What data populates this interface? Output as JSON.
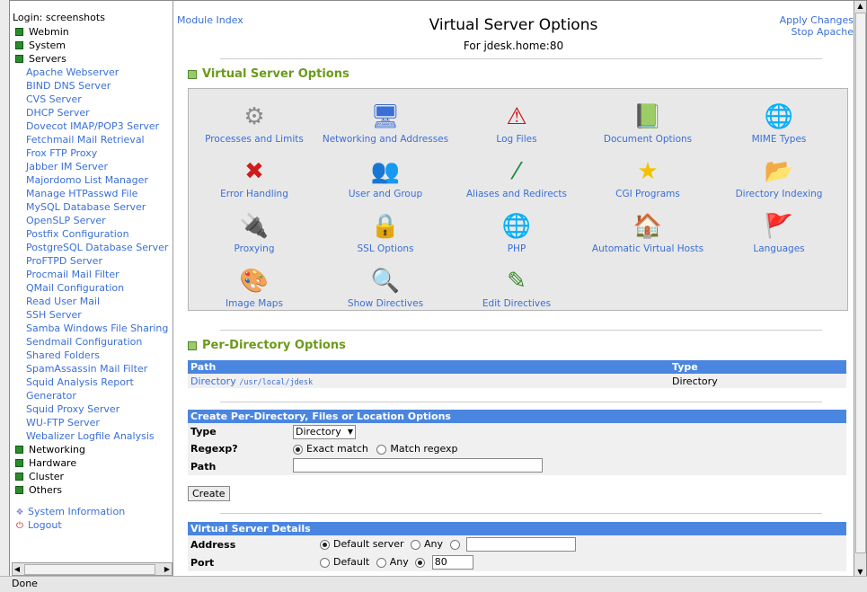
{
  "left": {
    "login": "Login: screenshots",
    "categories_top": [
      "Webmin",
      "System",
      "Servers"
    ],
    "servers": [
      "Apache Webserver",
      "BIND DNS Server",
      "CVS Server",
      "DHCP Server",
      "Dovecot IMAP/POP3 Server",
      "Fetchmail Mail Retrieval",
      "Frox FTP Proxy",
      "Jabber IM Server",
      "Majordomo List Manager",
      "Manage HTPasswd File",
      "MySQL Database Server",
      "OpenSLP Server",
      "Postfix Configuration",
      "PostgreSQL Database Server",
      "ProFTPD Server",
      "Procmail Mail Filter",
      "QMail Configuration",
      "Read User Mail",
      "SSH Server",
      "Samba Windows File Sharing",
      "Sendmail Configuration",
      "Shared Folders",
      "SpamAssassin Mail Filter",
      "Squid Analysis Report Generator",
      "Squid Proxy Server",
      "WU-FTP Server",
      "Webalizer Logfile Analysis"
    ],
    "categories_bottom": [
      "Networking",
      "Hardware",
      "Cluster",
      "Others"
    ],
    "system_info": "System Information",
    "logout": "Logout"
  },
  "header": {
    "module_index": "Module Index",
    "apply_changes": "Apply Changes",
    "stop_apache": "Stop Apache",
    "title": "Virtual Server Options",
    "subtitle": "For jdesk.home:80"
  },
  "vs_options": {
    "heading": "Virtual Server Options",
    "icons": [
      {
        "label": "Processes and Limits",
        "glyph": "⚙",
        "color": "#8a8a8a"
      },
      {
        "label": "Networking and Addresses",
        "glyph": "🖥",
        "color": "#3a6fd6"
      },
      {
        "label": "Log Files",
        "glyph": "⚠",
        "color": "#cc1111"
      },
      {
        "label": "Document Options",
        "glyph": "📗",
        "color": "#1f7a7a"
      },
      {
        "label": "MIME Types",
        "glyph": "🌐",
        "color": "#2a5fb0"
      },
      {
        "label": "Error Handling",
        "glyph": "✖",
        "color": "#d11a1a"
      },
      {
        "label": "User and Group",
        "glyph": "👥",
        "color": "#3a8ad6"
      },
      {
        "label": "Aliases and Redirects",
        "glyph": "⁄",
        "color": "#1a8a3a"
      },
      {
        "label": "CGI Programs",
        "glyph": "★",
        "color": "#f2c200"
      },
      {
        "label": "Directory Indexing",
        "glyph": "📂",
        "color": "#2a7fd6"
      },
      {
        "label": "Proxying",
        "glyph": "🔌",
        "color": "#c98a2a"
      },
      {
        "label": "SSL Options",
        "glyph": "🔒",
        "color": "#c99a00"
      },
      {
        "label": "PHP",
        "glyph": "🌐",
        "color": "#2a5fb0"
      },
      {
        "label": "Automatic Virtual Hosts",
        "glyph": "🏠",
        "color": "#c92020"
      },
      {
        "label": "Languages",
        "glyph": "🚩",
        "color": "#cc2020"
      },
      {
        "label": "Image Maps",
        "glyph": "🎨",
        "color": "#d08a2a"
      },
      {
        "label": "Show Directives",
        "glyph": "🔍",
        "color": "#2a6fd6"
      },
      {
        "label": "Edit Directives",
        "glyph": "✎",
        "color": "#3a8a2a"
      }
    ]
  },
  "per_dir": {
    "heading": "Per-Directory Options",
    "columns": [
      "Path",
      "Type"
    ],
    "rows": [
      {
        "path_prefix": "Directory",
        "path": "/usr/local/jdesk",
        "type": "Directory"
      }
    ]
  },
  "create_form": {
    "header": "Create Per-Directory, Files or Location Options",
    "type_label": "Type",
    "type_value": "Directory",
    "regexp_label": "Regexp?",
    "exact_match": "Exact match",
    "match_regexp": "Match regexp",
    "path_label": "Path",
    "path_value": "",
    "create_button": "Create"
  },
  "details": {
    "header": "Virtual Server Details",
    "address_label": "Address",
    "default_server": "Default server",
    "any": "Any",
    "address_value": "",
    "port_label": "Port",
    "default": "Default",
    "port_value": "80"
  },
  "status": "Done"
}
